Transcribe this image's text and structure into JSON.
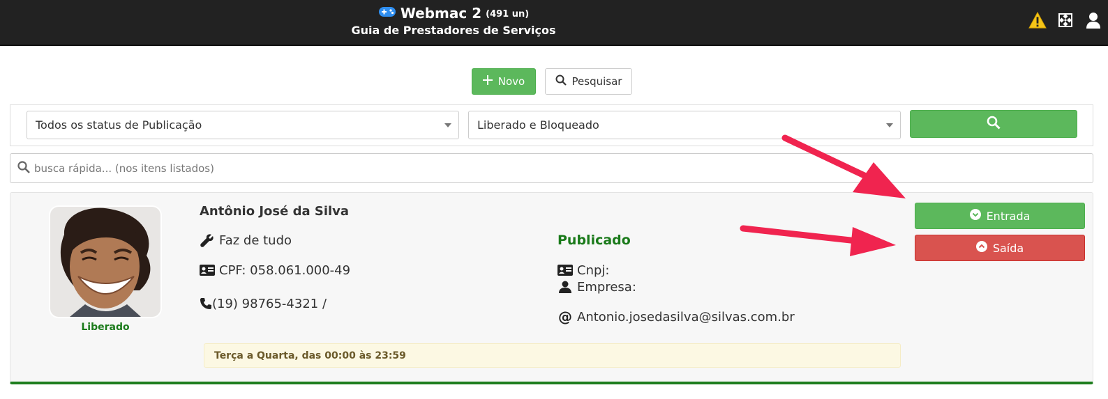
{
  "header": {
    "app_name": "Webmac 2",
    "count": "(491 un)",
    "subtitle": "Guia de Prestadores de Serviços",
    "icons": [
      "gamepad-icon",
      "warning-icon",
      "fullscreen-icon",
      "user-icon"
    ]
  },
  "toolbar": {
    "new_label": "Novo",
    "search_label": "Pesquisar"
  },
  "filters": {
    "publication_status": "Todos os status de Publicação",
    "access_status": "Liberado e Bloqueado"
  },
  "quick_search": {
    "placeholder": "busca rápida... (nos itens listados)"
  },
  "provider": {
    "name": "Antônio José da Silva",
    "service": "Faz de tudo",
    "cpf": "CPF: 058.061.000-49",
    "phone": "(19) 98765-4321 /",
    "status": "Liberado",
    "publication": "Publicado",
    "cnpj_label": "Cnpj:",
    "company_label": "Empresa:",
    "email": "Antonio.josedasilva@silvas.com.br",
    "schedule": "Terça a Quarta, das 00:00 às 23:59",
    "entry_label": "Entrada",
    "exit_label": "Saída"
  },
  "colors": {
    "header_bg": "#222222",
    "success": "#5cb85c",
    "danger": "#d9534f",
    "status_green": "#1a7a1a",
    "annotation_arrow": "#f0244f"
  }
}
